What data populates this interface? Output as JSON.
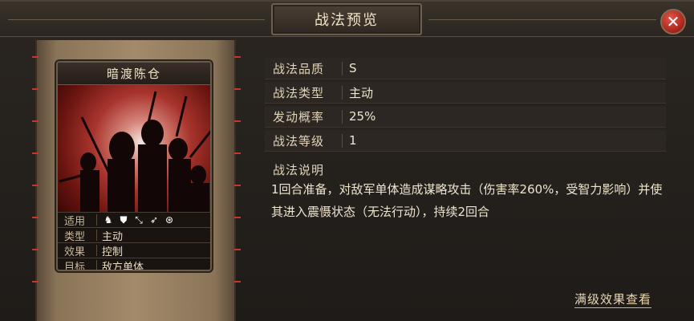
{
  "window": {
    "title": "战法预览",
    "close_icon": "close-icon"
  },
  "card": {
    "name": "暗渡陈仓",
    "rows": [
      {
        "label": "适用",
        "icons": [
          "cavalry-icon",
          "shield-icon",
          "bow-icon",
          "spear-icon",
          "wheel-icon"
        ]
      },
      {
        "label": "类型",
        "value": "主动"
      },
      {
        "label": "效果",
        "value": "控制"
      },
      {
        "label": "目标",
        "value": "敌方单体"
      }
    ]
  },
  "props": [
    {
      "label": "战法品质",
      "value": "S"
    },
    {
      "label": "战法类型",
      "value": "主动"
    },
    {
      "label": "发动概率",
      "value": "25%"
    },
    {
      "label": "战法等级",
      "value": "1"
    }
  ],
  "description": {
    "title": "战法说明",
    "text": "1回合准备，对敌军单体造成谋略攻击（伤害率260%，受智力影响）并使其进入震慑状态（无法行动），持续2回合"
  },
  "full_effect_link": "满级效果查看"
}
